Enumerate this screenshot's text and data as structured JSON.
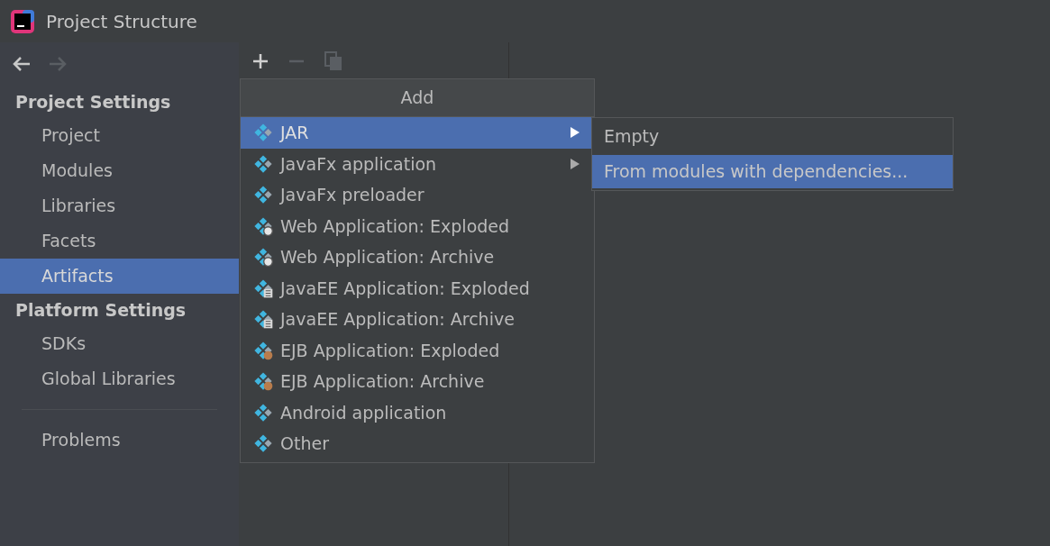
{
  "window": {
    "title": "Project Structure"
  },
  "sidebar": {
    "sections": [
      {
        "heading": "Project Settings",
        "items": [
          {
            "label": "Project",
            "selected": false
          },
          {
            "label": "Modules",
            "selected": false
          },
          {
            "label": "Libraries",
            "selected": false
          },
          {
            "label": "Facets",
            "selected": false
          },
          {
            "label": "Artifacts",
            "selected": true
          }
        ]
      },
      {
        "heading": "Platform Settings",
        "items": [
          {
            "label": "SDKs",
            "selected": false
          },
          {
            "label": "Global Libraries",
            "selected": false
          }
        ]
      }
    ],
    "footer_items": [
      {
        "label": "Problems",
        "selected": false
      }
    ]
  },
  "toolbar": {
    "back_disabled": false,
    "forward_disabled": true,
    "remove_disabled": true,
    "copy_disabled": true
  },
  "add_menu": {
    "title": "Add",
    "items": [
      {
        "label": "JAR",
        "kind": "plain",
        "submenu": true,
        "selected": true
      },
      {
        "label": "JavaFx application",
        "kind": "plain",
        "submenu": true,
        "selected": false
      },
      {
        "label": "JavaFx preloader",
        "kind": "plain",
        "submenu": false,
        "selected": false
      },
      {
        "label": "Web Application: Exploded",
        "kind": "web",
        "submenu": false,
        "selected": false
      },
      {
        "label": "Web Application: Archive",
        "kind": "web",
        "submenu": false,
        "selected": false
      },
      {
        "label": "JavaEE Application: Exploded",
        "kind": "javaee",
        "submenu": false,
        "selected": false
      },
      {
        "label": "JavaEE Application: Archive",
        "kind": "javaee",
        "submenu": false,
        "selected": false
      },
      {
        "label": "EJB Application: Exploded",
        "kind": "ejb",
        "submenu": false,
        "selected": false
      },
      {
        "label": "EJB Application: Archive",
        "kind": "ejb",
        "submenu": false,
        "selected": false
      },
      {
        "label": "Android application",
        "kind": "plain",
        "submenu": false,
        "selected": false
      },
      {
        "label": "Other",
        "kind": "plain",
        "submenu": false,
        "selected": false
      }
    ]
  },
  "submenu": {
    "items": [
      {
        "label": "Empty",
        "selected": false
      },
      {
        "label": "From modules with dependencies...",
        "selected": true
      }
    ]
  }
}
